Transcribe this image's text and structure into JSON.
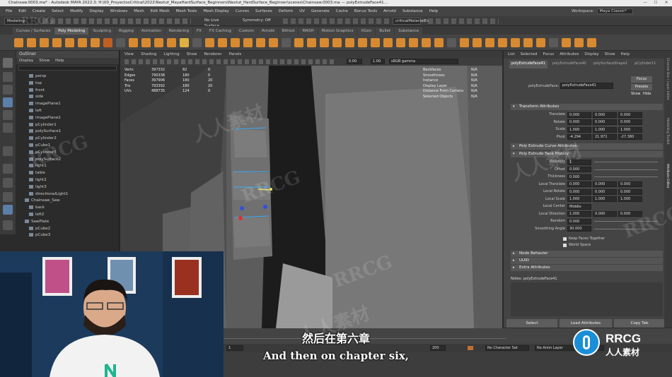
{
  "window": {
    "title": "Chainsaw.0003.ma* - Autodesk MAYA 2022.3: H:\\00_ProyectosCritical\\2022\\Nextut_MayaHardSurface_Beginners\\Nextut_HardSurface_Beginner\\scenes\\Chainsaw.0003.ma --- polyExtrudeFace41...",
    "minimize": "—",
    "maximize": "☐",
    "close": "✕"
  },
  "menubar": [
    "File",
    "Edit",
    "Create",
    "Select",
    "Modify",
    "Display",
    "Windows",
    "Mesh",
    "Edit Mesh",
    "Mesh Tools",
    "Mesh Display",
    "Curves",
    "Surfaces",
    "Deform",
    "UV",
    "Generate",
    "Cache",
    "Bonus Tools",
    "Arnold",
    "Substance",
    "Help"
  ],
  "workspace": {
    "label": "Workspace:",
    "value": "Maya Classic*"
  },
  "statusline": {
    "mode": "Modeling",
    "live_surface": "No Live Surface",
    "symmetry": "Symmetry: Off",
    "object_name": "criticalMaterialEx"
  },
  "shelf_tabs": [
    "Curves / Surfaces",
    "Poly Modeling",
    "Sculpting",
    "Rigging",
    "Animation",
    "Rendering",
    "FX",
    "FX Caching",
    "Custom",
    "Arnold",
    "Bifrost",
    "MASH",
    "Motion Graphics",
    "XGen",
    "Bullet",
    "Substance"
  ],
  "shelf_active": "Poly Modeling",
  "outliner": {
    "title": "Outliner",
    "menu": [
      "Display",
      "Show",
      "Help"
    ],
    "items": [
      "persp",
      "top",
      "front",
      "side",
      "imagePlane1",
      "left",
      "imagePlane2",
      "pCylinder1",
      "polySurface1",
      "pCylinder2",
      "pCube1",
      "pCylinder3",
      "polySurface2",
      "light1",
      "table",
      "light2",
      "light3",
      "directionalLight1",
      "Chainsaw_Saw",
      "back",
      "left2",
      "SawPlate",
      "pCube2",
      "pCube3"
    ]
  },
  "viewport": {
    "menu": [
      "View",
      "Shading",
      "Lighting",
      "Show",
      "Renderer",
      "Panels"
    ],
    "exposure": "0.00",
    "gamma": "1.00",
    "color_space": "sRGB gamma",
    "hud_left": [
      {
        "label": "Verts",
        "a": "397332",
        "b": "82",
        "c": "0"
      },
      {
        "label": "Edges",
        "a": "790338",
        "b": "180",
        "c": "0"
      },
      {
        "label": "Faces",
        "a": "397906",
        "b": "180",
        "c": "20"
      },
      {
        "label": "Tris",
        "a": "793392",
        "b": "180",
        "c": "20"
      },
      {
        "label": "UVs",
        "a": "488735",
        "b": "124",
        "c": "0"
      }
    ],
    "hud_right": [
      {
        "label": "Backfaces",
        "value": "N/A"
      },
      {
        "label": "Smoothness",
        "value": "N/A"
      },
      {
        "label": "Instance",
        "value": "N/A"
      },
      {
        "label": "Display Layer",
        "value": "N/A"
      },
      {
        "label": "Distance From Camera",
        "value": "N/A"
      },
      {
        "label": "Selected Objects",
        "value": "N/A"
      }
    ]
  },
  "attribute_editor": {
    "menu": [
      "List",
      "Selected",
      "Focus",
      "Attributes",
      "Display",
      "Show",
      "Help"
    ],
    "tabs": [
      "polyExtrudeFace41",
      "polyExtrudeFace40",
      "polySurfaceShape1",
      "pCylinder11"
    ],
    "active_tab": "polyExtrudeFace41",
    "node_label": "polyExtrudeFace:",
    "node_value": "polyExtrudeFace41",
    "focus_btn": "Focus",
    "presets_btn": "Presets",
    "show_btn": "Show",
    "hide_btn": "Hide",
    "sections": {
      "transform": "Transform Attributes",
      "extrude_curve": "Poly Extrude Curve Attributes",
      "extrude_face_history": "Poly Extrude Face History",
      "node_behavior": "Node Behavior",
      "uuid": "UUID",
      "extra": "Extra Attributes"
    },
    "transform_rows": [
      {
        "label": "Translate",
        "values": [
          "0.000",
          "0.000",
          "0.000"
        ]
      },
      {
        "label": "Rotate",
        "values": [
          "0.000",
          "0.000",
          "0.000"
        ]
      },
      {
        "label": "Scale",
        "values": [
          "1.000",
          "1.000",
          "1.000"
        ]
      },
      {
        "label": "Pivot",
        "values": [
          "-4.294",
          "21.971",
          "-27.380"
        ]
      }
    ],
    "history_rows": [
      {
        "label": "Divisions",
        "values": [
          "1"
        ]
      },
      {
        "label": "Offset",
        "values": [
          "0.000"
        ]
      },
      {
        "label": "Thickness",
        "values": [
          "0.000"
        ]
      },
      {
        "label": "Local Translate",
        "values": [
          "0.000",
          "0.000",
          "0.000"
        ]
      },
      {
        "label": "Local Rotate",
        "values": [
          "0.000",
          "0.000",
          "0.000"
        ]
      },
      {
        "label": "Local Scale",
        "values": [
          "1.000",
          "1.000",
          "1.000"
        ]
      },
      {
        "label": "Local Center",
        "values": [
          "Middle"
        ]
      },
      {
        "label": "Local Direction",
        "values": [
          "1.000",
          "0.000",
          "0.000"
        ]
      },
      {
        "label": "Random",
        "values": [
          "0.000"
        ]
      },
      {
        "label": "Smoothing Angle",
        "values": [
          "30.000"
        ]
      }
    ],
    "checkboxes": [
      "Keep Faces Together",
      "World Space"
    ],
    "notes_label": "Notes: polyExtrudeFace41",
    "buttons": [
      "Select",
      "Load Attributes",
      "Copy Tab"
    ]
  },
  "right_strip_labels": [
    "Channel Box / Layer Editor",
    "Modelling Toolkit",
    "Attribute Editor"
  ],
  "timeline": {
    "start": "1",
    "end": "120",
    "range_end": "200",
    "char_set": "No Character Set",
    "anim_layer": "No Anim Layer",
    "fps": "24 fps"
  },
  "subtitles": {
    "chinese": "然后在第六章",
    "english": "And then on chapter six,"
  },
  "watermarks": {
    "brand": "RRCG",
    "cn": "人人素材"
  },
  "logo": {
    "name": "RRCG",
    "tagline": "人人素材"
  }
}
